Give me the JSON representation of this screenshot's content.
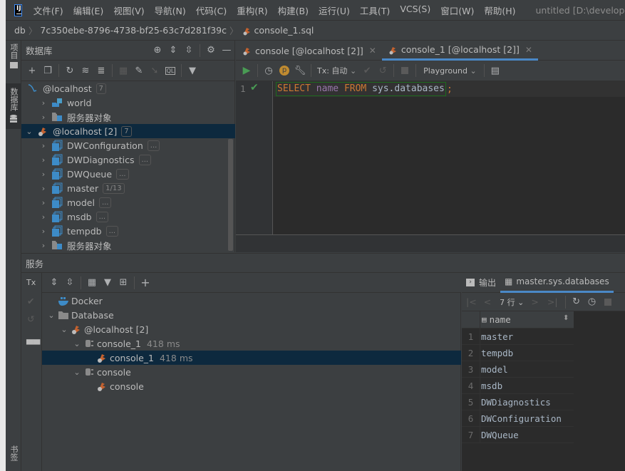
{
  "app": {
    "menu": [
      "文件(F)",
      "编辑(E)",
      "视图(V)",
      "导航(N)",
      "代码(C)",
      "重构(R)",
      "构建(B)",
      "运行(U)",
      "工具(T)",
      "VCS(S)",
      "窗口(W)",
      "帮助(H)"
    ],
    "window_title": "untitled [D:\\development\\untit",
    "logo_text": "IJ"
  },
  "breadcrumb": [
    "db",
    "7c350ebe-8796-4738-bf25-63c7d281f39c",
    "console_1.sql"
  ],
  "left_strip": {
    "project_tab": "项目",
    "database_tab": "数据库",
    "bookmarks_tab": "书签"
  },
  "db_panel": {
    "title": "数据库",
    "tree": [
      {
        "label": "@localhost",
        "badge": "7",
        "level": 0,
        "expanded": true,
        "icon": "mysql-icon"
      },
      {
        "label": "world",
        "level": 1,
        "icon": "schema-icon"
      },
      {
        "label": "服务器对象",
        "level": 1,
        "icon": "server-objects-icon"
      },
      {
        "label": "@localhost [2]",
        "badge": "7",
        "level": 0,
        "expanded": true,
        "icon": "mssql-icon",
        "selected": true
      },
      {
        "label": "DWConfiguration",
        "badge": "...",
        "level": 1,
        "icon": "database-icon"
      },
      {
        "label": "DWDiagnostics",
        "badge": "...",
        "level": 1,
        "icon": "database-icon"
      },
      {
        "label": "DWQueue",
        "badge": "...",
        "level": 1,
        "icon": "database-icon"
      },
      {
        "label": "master",
        "badge": "1/13",
        "level": 1,
        "icon": "database-icon"
      },
      {
        "label": "model",
        "badge": "...",
        "level": 1,
        "icon": "database-icon"
      },
      {
        "label": "msdb",
        "badge": "...",
        "level": 1,
        "icon": "database-icon"
      },
      {
        "label": "tempdb",
        "badge": "...",
        "level": 1,
        "icon": "database-icon"
      },
      {
        "label": "服务器对象",
        "level": 1,
        "icon": "server-objects-icon"
      }
    ]
  },
  "editor": {
    "tabs": [
      {
        "label": "console [@localhost [2]]",
        "active": false
      },
      {
        "label": "console_1 [@localhost [2]]",
        "active": true
      }
    ],
    "tx_label": "Tx: 自动",
    "playground_label": "Playground",
    "line_number": "1",
    "code": {
      "kw1": "SELECT",
      "ident": "name",
      "kw2": "FROM",
      "rest": "sys.databases",
      "semi": ";"
    }
  },
  "services": {
    "title": "服务",
    "tx_label": "Tx",
    "tree": [
      {
        "label": "Docker",
        "level": 0,
        "icon": "docker-icon"
      },
      {
        "label": "Database",
        "level": 0,
        "expanded": true,
        "icon": "folder-icon"
      },
      {
        "label": "@localhost [2]",
        "level": 1,
        "expanded": true,
        "icon": "mssql-icon"
      },
      {
        "label": "console_1",
        "time": "418 ms",
        "level": 2,
        "expanded": true,
        "icon": "session-icon"
      },
      {
        "label": "console_1",
        "time": "418 ms",
        "level": 3,
        "icon": "mssql-icon",
        "selected": true
      },
      {
        "label": "console",
        "level": 2,
        "expanded": true,
        "icon": "session-icon"
      },
      {
        "label": "console",
        "level": 3,
        "icon": "mssql-icon"
      }
    ]
  },
  "results": {
    "output_tab": "输出",
    "table_tab": "master.sys.databases",
    "rows_label": "7 行",
    "column": "name",
    "rows": [
      "master",
      "tempdb",
      "model",
      "msdb",
      "DWDiagnostics",
      "DWConfiguration",
      "DWQueue"
    ]
  }
}
